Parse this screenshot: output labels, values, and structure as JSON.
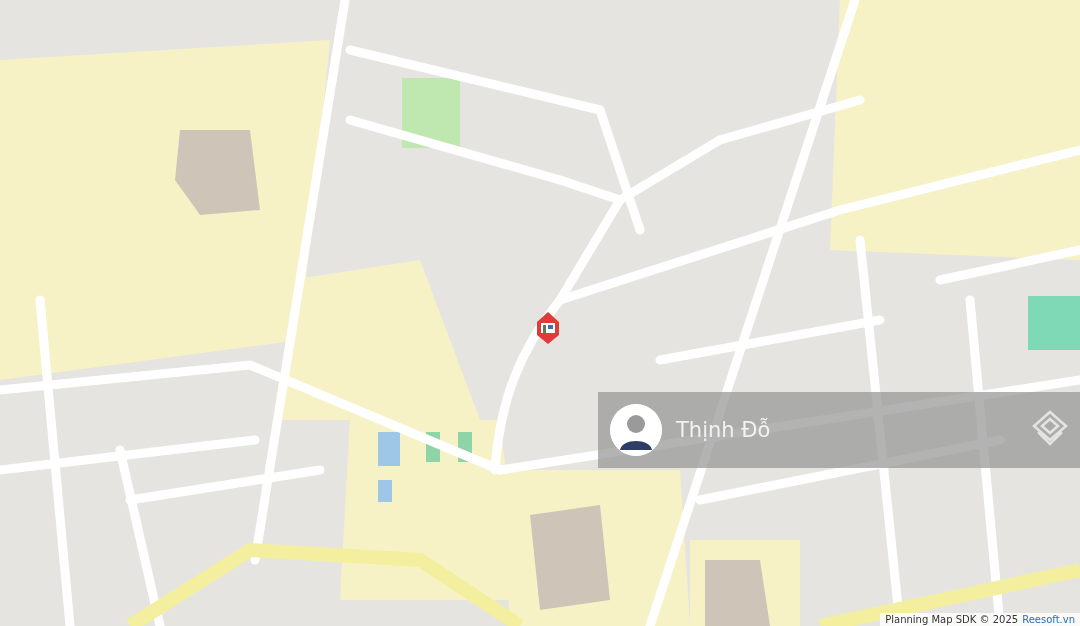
{
  "agent_banner": {
    "name": "Thịnh Đỗ"
  },
  "attribution": {
    "text": "Planning Map SDK © 2025",
    "link": "Reesoft.vn"
  }
}
